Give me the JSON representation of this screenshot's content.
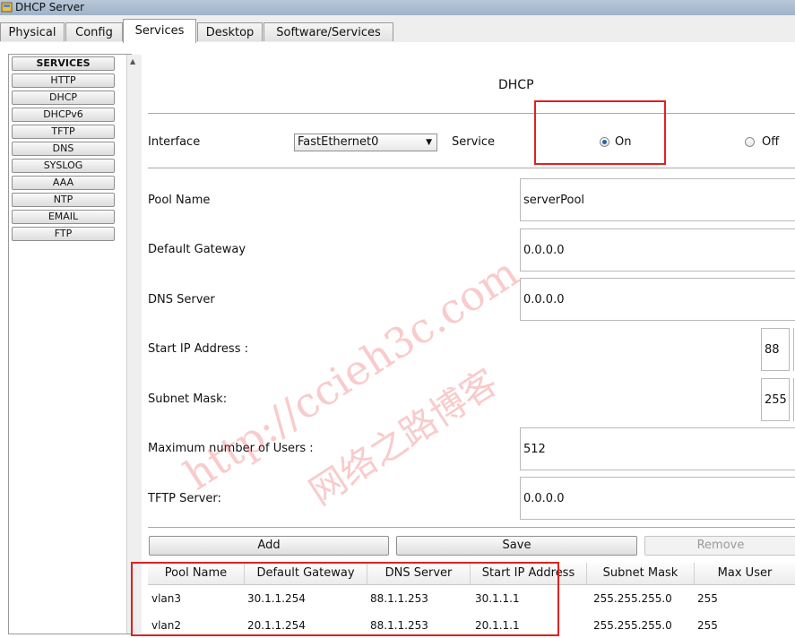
{
  "window": {
    "title": "DHCP Server"
  },
  "tabs": [
    {
      "label": "Physical"
    },
    {
      "label": "Config"
    },
    {
      "label": "Services",
      "active": true
    },
    {
      "label": "Desktop"
    },
    {
      "label": "Software/Services"
    }
  ],
  "sidebar": {
    "header": "SERVICES",
    "items": [
      "HTTP",
      "DHCP",
      "DHCPv6",
      "TFTP",
      "DNS",
      "SYSLOG",
      "AAA",
      "NTP",
      "EMAIL",
      "FTP"
    ]
  },
  "dhcp": {
    "title": "DHCP",
    "interface_label": "Interface",
    "interface_value": "FastEthernet0",
    "service_label": "Service",
    "on_label": "On",
    "off_label": "Off",
    "service_state": "On",
    "pool_name_label": "Pool Name",
    "pool_name_value": "serverPool",
    "default_gateway_label": "Default Gateway",
    "default_gateway_value": "0.0.0.0",
    "dns_server_label": "DNS Server",
    "dns_server_value": "0.0.0.0",
    "start_ip_label": "Start IP Address :",
    "start_ip_first_octet": "88",
    "subnet_mask_label": "Subnet Mask:",
    "subnet_mask_first_octet": "255",
    "max_users_label": "Maximum number of Users :",
    "max_users_value": "512",
    "tftp_label": "TFTP Server:",
    "tftp_value": "0.0.0.0"
  },
  "actions": {
    "add": "Add",
    "save": "Save",
    "remove": "Remove"
  },
  "table": {
    "columns": [
      "Pool Name",
      "Default Gateway",
      "DNS Server",
      "Start IP Address",
      "Subnet Mask",
      "Max User"
    ],
    "rows": [
      [
        "vlan3",
        "30.1.1.254",
        "88.1.1.253",
        "30.1.1.1",
        "255.255.255.0",
        "255"
      ],
      [
        "vlan2",
        "20.1.1.254",
        "88.1.1.253",
        "20.1.1.1",
        "255.255.255.0",
        "255"
      ]
    ]
  },
  "watermark": {
    "line1": "http://ccieh3c.com",
    "line2": "网络之路博客"
  },
  "colors": {
    "highlight": "#e02020",
    "watermark": "#eb4646",
    "radio_selected": "#2b5fa8"
  }
}
